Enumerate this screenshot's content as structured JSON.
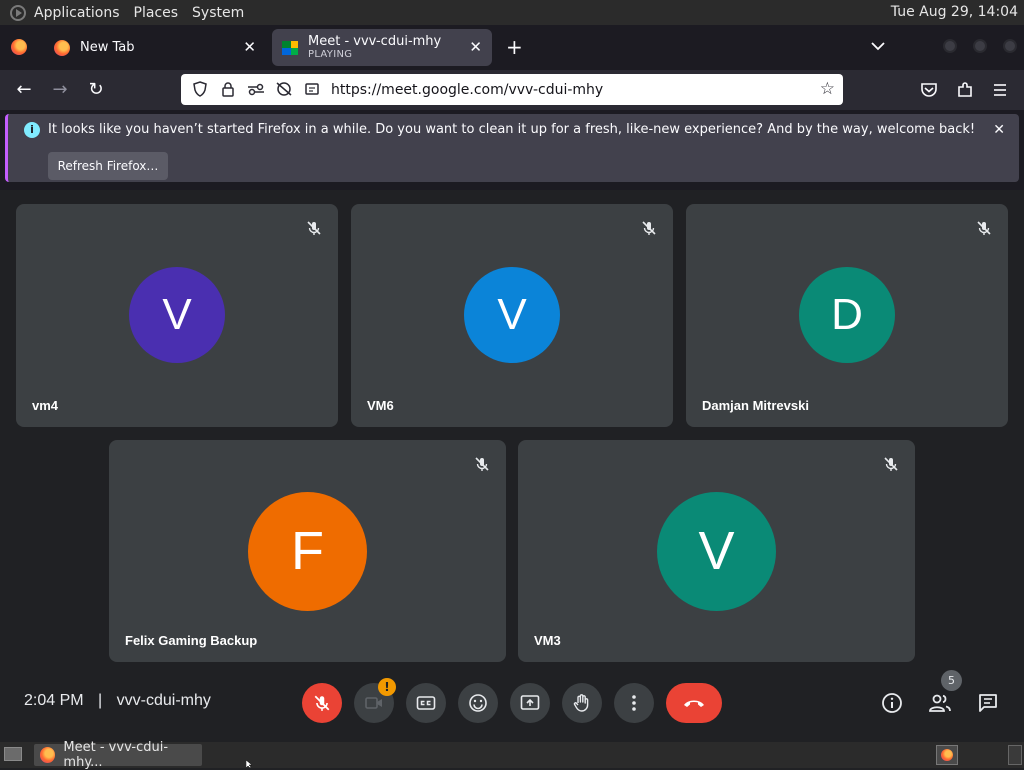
{
  "panel": {
    "menus": [
      "Applications",
      "Places",
      "System"
    ],
    "clock": "Tue Aug 29, 14:04"
  },
  "tabs": {
    "new_tab_label": "New Tab",
    "meet_title": "Meet - vvv-cdui-mhy",
    "meet_status": "PLAYING"
  },
  "navbar": {
    "url": "https://meet.google.com/vvv-cdui-mhy"
  },
  "notification": {
    "message": "It looks like you haven’t started Firefox in a while. Do you want to clean it up for a fresh, like-new experience? And by the way, welcome back!",
    "button": "Refresh Firefox…"
  },
  "meet": {
    "participants": [
      {
        "initial": "V",
        "name": "vm4",
        "color": "#4a2fb0"
      },
      {
        "initial": "V",
        "name": "VM6",
        "color": "#0b84d8"
      },
      {
        "initial": "D",
        "name": "Damjan Mitrevski",
        "color": "#0a8a76"
      },
      {
        "initial": "F",
        "name": "Felix Gaming Backup",
        "color": "#ef6c00"
      },
      {
        "initial": "V",
        "name": "VM3",
        "color": "#0a8a76"
      }
    ],
    "time": "2:04 PM",
    "separator": "|",
    "meeting_code": "vvv-cdui-mhy",
    "people_count": "5",
    "camera_alert": "!",
    "colors": {
      "leave": "#ea4335",
      "muted_mic": "#ea4335",
      "alert": "#f29900"
    }
  },
  "taskbar": {
    "item_label": "Meet - vvv-cdui-mhy..."
  }
}
